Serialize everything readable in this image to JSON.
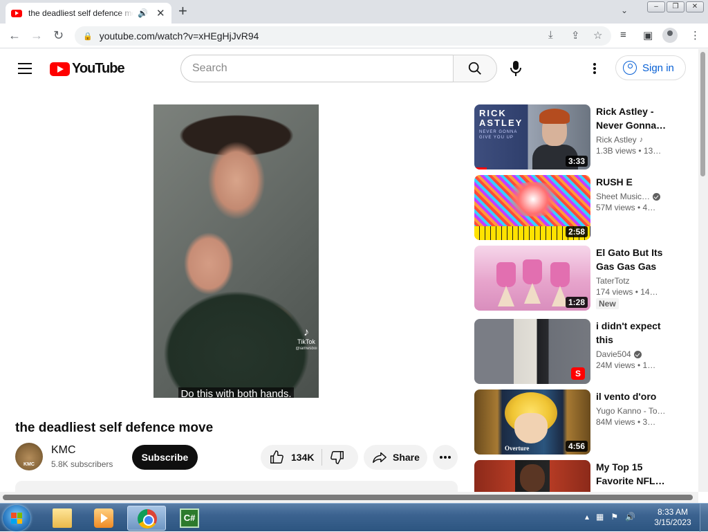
{
  "browser": {
    "tab_title": "the deadliest self defence move",
    "address": "youtube.com/watch?v=xHEgHjJvR94"
  },
  "masthead": {
    "logo_text": "YouTube",
    "search_placeholder": "Search",
    "signin_label": "Sign in"
  },
  "video": {
    "caption": "Do this with both hands.",
    "watermark": "TikTok",
    "watermark_handle": "@iamwsboi",
    "title": "the deadliest self defence move",
    "channel": "KMC",
    "channel_avatar_text": "KMC",
    "subscribers": "5.8K subscribers",
    "subscribe_label": "Subscribe",
    "likes": "134K",
    "share_label": "Share"
  },
  "recommendations": [
    {
      "title": "Rick Astley - Never Gonna…",
      "channel": "Rick Astley",
      "meta": "1.3B views • 13…",
      "duration": "3:33",
      "thumb_text_1": "RICK",
      "thumb_text_2": "ASTLEY",
      "thumb_sub_1": "NEVER GONNA",
      "thumb_sub_2": "GIVE YOU UP"
    },
    {
      "title": "RUSH E",
      "channel": "Sheet Music…",
      "meta": "57M views • 4…",
      "duration": "2:58"
    },
    {
      "title": "El Gato But Its Gas Gas Gas",
      "channel": "TaterTotz",
      "meta": "174 views • 14…",
      "duration": "1:28",
      "badge": "New"
    },
    {
      "title": "i didn't expect this",
      "channel": "Davie504",
      "meta": "24M views • 1…"
    },
    {
      "title": "il vento d'oro",
      "channel": "Yugo Kanno - To…",
      "meta": "84M views • 3…",
      "duration": "4:56",
      "thumb_text": "Overture"
    },
    {
      "title": "My Top 15 Favorite NFL…"
    }
  ],
  "taskbar": {
    "time": "8:33 AM",
    "date": "3/15/2023",
    "cs_label": "C#"
  }
}
